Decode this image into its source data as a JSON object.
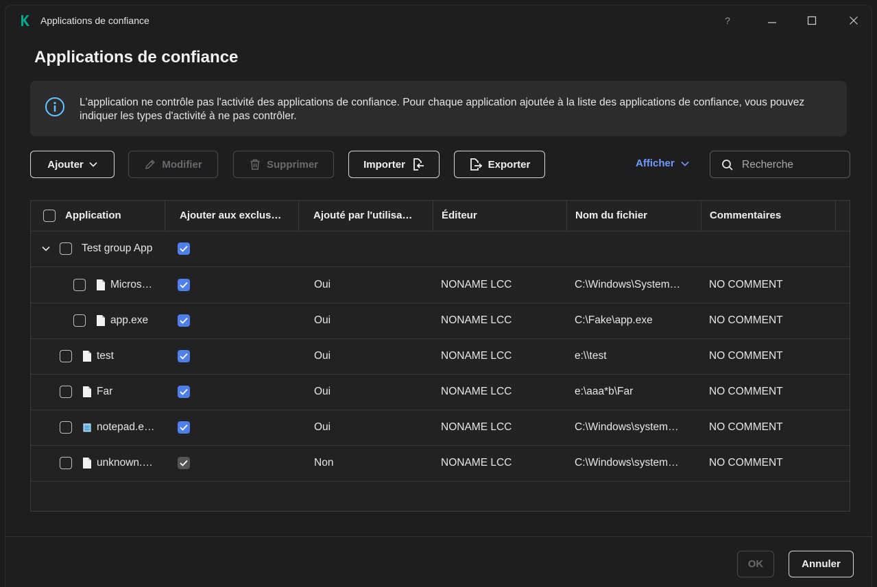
{
  "window": {
    "title": "Applications de confiance",
    "help": "?",
    "minimize": "—",
    "maximize": "☐",
    "close": "✕"
  },
  "page": {
    "title": "Applications de confiance"
  },
  "info": {
    "text": "L'application ne contrôle pas l'activité des applications de confiance. Pour chaque application ajoutée à la liste des applications de confiance, vous pouvez indiquer les types d'activité à ne pas contrôler."
  },
  "toolbar": {
    "add": "Ajouter",
    "modify": "Modifier",
    "delete": "Supprimer",
    "import": "Importer",
    "export": "Exporter",
    "view": "Afficher",
    "search_placeholder": "Recherche"
  },
  "table": {
    "columns": [
      "Application",
      "Ajouter aux exclus…",
      "Ajouté par l'utilisa…",
      "Éditeur",
      "Nom du fichier",
      "Commentaires"
    ],
    "rows": [
      {
        "name": "Test group App",
        "group": true,
        "exclude": true,
        "added_by_user": "",
        "publisher": "",
        "filename": "",
        "comment": ""
      },
      {
        "name": "Micros…",
        "child": true,
        "exclude": true,
        "added_by_user": "Oui",
        "publisher": "NONAME LCC",
        "filename": "C:\\Windows\\System…",
        "comment": "NO COMMENT"
      },
      {
        "name": "app.exe",
        "child": true,
        "exclude": true,
        "added_by_user": "Oui",
        "publisher": "NONAME LCC",
        "filename": "C:\\Fake\\app.exe",
        "comment": "NO COMMENT"
      },
      {
        "name": "test",
        "exclude": true,
        "added_by_user": "Oui",
        "publisher": "NONAME LCC",
        "filename": "e:\\\\test",
        "comment": "NO COMMENT"
      },
      {
        "name": "Far",
        "exclude": true,
        "added_by_user": "Oui",
        "publisher": "NONAME LCC",
        "filename": "e:\\aaa*b\\Far",
        "comment": "NO COMMENT"
      },
      {
        "name": "notepad.e…",
        "icon": "notepad-icon",
        "exclude": true,
        "added_by_user": "Oui",
        "publisher": "NONAME LCC",
        "filename": "C:\\Windows\\system…",
        "comment": "NO COMMENT"
      },
      {
        "name": "unknown.…",
        "exclude": true,
        "exclude_disabled": true,
        "added_by_user": "Non",
        "publisher": "NONAME LCC",
        "filename": "C:\\Windows\\system…",
        "comment": "NO COMMENT"
      }
    ]
  },
  "footer": {
    "ok": "OK",
    "cancel": "Annuler"
  },
  "colors": {
    "accent": "#4f7fe8",
    "link": "#6f9bff",
    "logo": "#00a88e",
    "info_icon": "#5ec8ff"
  }
}
